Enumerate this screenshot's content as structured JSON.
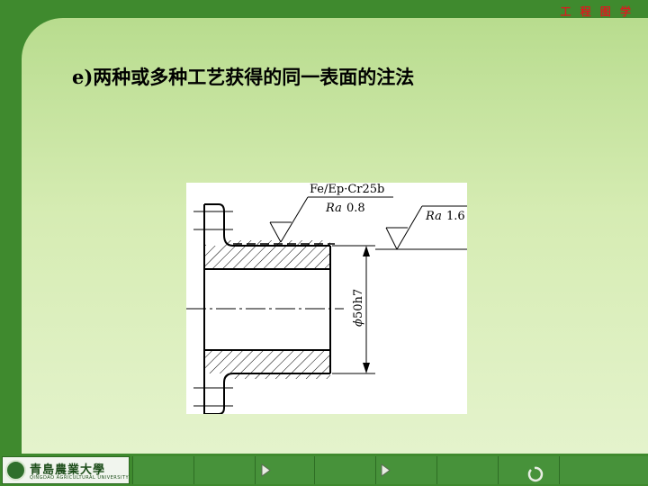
{
  "header": {
    "brand": "工 程 图 学"
  },
  "slide": {
    "title": "e)两种或多种工艺获得的同一表面的注法"
  },
  "drawing": {
    "coating_note": "Fe/Ep·Cr25b",
    "roughness_1_label": "Ra",
    "roughness_1_value": "0.8",
    "roughness_2_label": "Ra",
    "roughness_2_value": "1.6",
    "diameter_symbol": "ϕ",
    "diameter_value": "50h7"
  },
  "footer": {
    "logo_text": "青島農業大學",
    "logo_sub": "QINGDAO AGRICULTURAL UNIVERSITY",
    "buttons": [
      "previous",
      "next",
      "return"
    ]
  },
  "colors": {
    "frame": "#3f8a2e",
    "brand": "#d42020",
    "content_top": "#b8dc8e",
    "content_bottom": "#e4f3cc"
  }
}
